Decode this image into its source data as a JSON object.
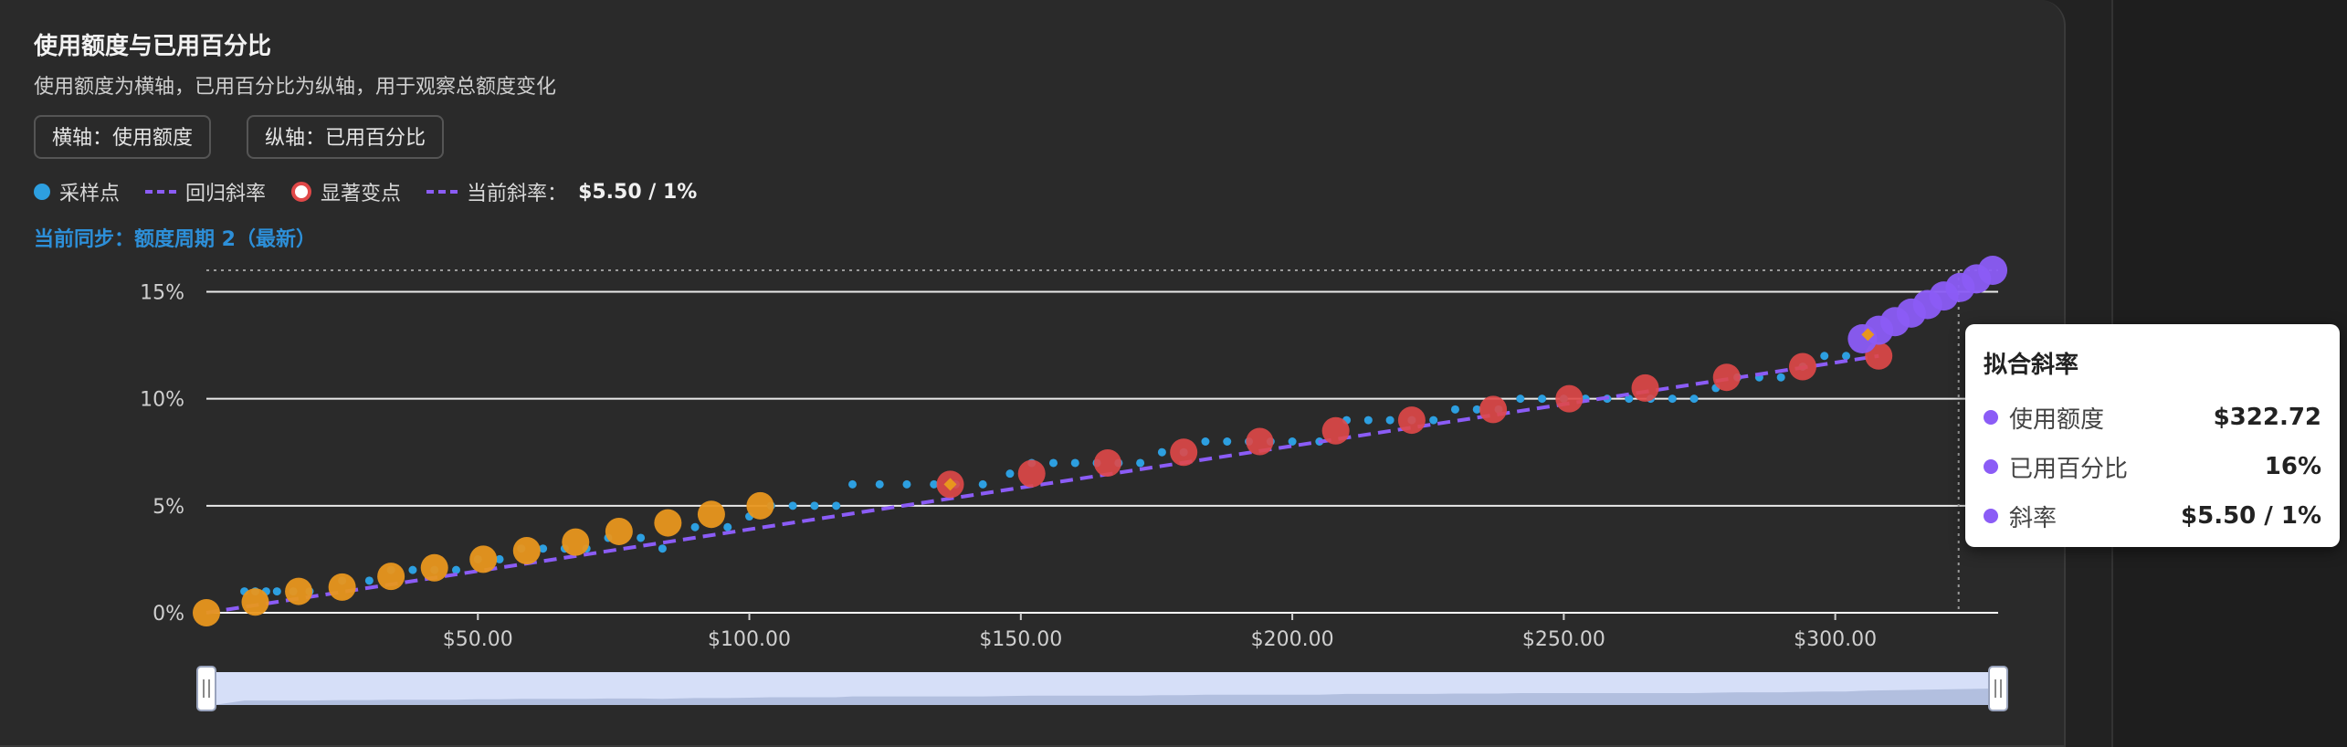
{
  "header": {
    "title": "使用额度与已用百分比",
    "subtitle": "使用额度为横轴，已用百分比为纵轴，用于观察总额度变化",
    "x_axis_button": "横轴：使用额度",
    "y_axis_button": "纵轴：已用百分比"
  },
  "legend": {
    "samples": "采样点",
    "regression": "回归斜率",
    "changepoints": "显著变点",
    "current_slope_label": "当前斜率：",
    "current_slope_value": "$5.50 / 1%"
  },
  "sync_status": "当前同步：额度周期 2（最新）",
  "colors": {
    "sample": "#2d9fe0",
    "regression": "#8b5cf6",
    "changepoint": "#e04848",
    "cycle1": "#e8961e",
    "current": "#8b5cf6",
    "grid": "#ffffff",
    "zoom_fill": "#d6dff8"
  },
  "chart_data": {
    "type": "scatter",
    "xlim": [
      0,
      330
    ],
    "ylim": [
      0,
      16
    ],
    "x_ticks": [
      "$50.00",
      "$100.00",
      "$150.00",
      "$200.00",
      "$250.00",
      "$300.00"
    ],
    "x_tick_values": [
      50,
      100,
      150,
      200,
      250,
      300
    ],
    "y_ticks": [
      "0%",
      "5%",
      "10%",
      "15%"
    ],
    "y_tick_values": [
      0,
      5,
      10,
      15
    ],
    "grid": true,
    "reference_line_y": 16,
    "crosshair_x": 322.72,
    "samples": [
      [
        7,
        1
      ],
      [
        9,
        1
      ],
      [
        11,
        1
      ],
      [
        13,
        1
      ],
      [
        16,
        1
      ],
      [
        19,
        1
      ],
      [
        25,
        1.5
      ],
      [
        30,
        1.5
      ],
      [
        34,
        2
      ],
      [
        38,
        2
      ],
      [
        42,
        2
      ],
      [
        46,
        2
      ],
      [
        50,
        2.5
      ],
      [
        54,
        2.5
      ],
      [
        58,
        3
      ],
      [
        62,
        3
      ],
      [
        66,
        3
      ],
      [
        70,
        3
      ],
      [
        74,
        3.5
      ],
      [
        80,
        3.5
      ],
      [
        84,
        3
      ],
      [
        90,
        4
      ],
      [
        96,
        4
      ],
      [
        100,
        4.5
      ],
      [
        104,
        5
      ],
      [
        108,
        5
      ],
      [
        112,
        5
      ],
      [
        116,
        5
      ],
      [
        119,
        6
      ],
      [
        124,
        6
      ],
      [
        129,
        6
      ],
      [
        134,
        6
      ],
      [
        138,
        6
      ],
      [
        143,
        6
      ],
      [
        148,
        6.5
      ],
      [
        152,
        7
      ],
      [
        156,
        7
      ],
      [
        160,
        7
      ],
      [
        164,
        7
      ],
      [
        168,
        7
      ],
      [
        172,
        7
      ],
      [
        176,
        7.5
      ],
      [
        180,
        7.5
      ],
      [
        184,
        8
      ],
      [
        188,
        8
      ],
      [
        192,
        8
      ],
      [
        196,
        8
      ],
      [
        200,
        8
      ],
      [
        205,
        8
      ],
      [
        210,
        9
      ],
      [
        214,
        9
      ],
      [
        218,
        9
      ],
      [
        222,
        9
      ],
      [
        226,
        9
      ],
      [
        230,
        9.5
      ],
      [
        234,
        9.5
      ],
      [
        238,
        9.5
      ],
      [
        242,
        10
      ],
      [
        246,
        10
      ],
      [
        250,
        10
      ],
      [
        254,
        10
      ],
      [
        258,
        10
      ],
      [
        262,
        10
      ],
      [
        266,
        10
      ],
      [
        270,
        10
      ],
      [
        274,
        10
      ],
      [
        278,
        10.5
      ],
      [
        282,
        11
      ],
      [
        286,
        11
      ],
      [
        290,
        11
      ],
      [
        294,
        11.5
      ],
      [
        298,
        12
      ],
      [
        302,
        12
      ],
      [
        306,
        13
      ]
    ],
    "regression": {
      "x": [
        0,
        308
      ],
      "y": [
        0,
        12
      ]
    },
    "changepoints": [
      [
        137,
        6
      ],
      [
        152,
        6.5
      ],
      [
        166,
        7
      ],
      [
        180,
        7.5
      ],
      [
        194,
        8
      ],
      [
        208,
        8.5
      ],
      [
        222,
        9
      ],
      [
        237,
        9.5
      ],
      [
        251,
        10
      ],
      [
        265,
        10.5
      ],
      [
        280,
        11
      ],
      [
        294,
        11.5
      ],
      [
        308,
        12
      ]
    ],
    "cycle1_points": [
      [
        0,
        0
      ],
      [
        9,
        0.5
      ],
      [
        17,
        1
      ],
      [
        25,
        1.2
      ],
      [
        34,
        1.7
      ],
      [
        42,
        2.1
      ],
      [
        51,
        2.5
      ],
      [
        59,
        2.9
      ],
      [
        68,
        3.3
      ],
      [
        76,
        3.8
      ],
      [
        85,
        4.2
      ],
      [
        93,
        4.6
      ],
      [
        102,
        5
      ]
    ],
    "current_points": [
      [
        305,
        12.8
      ],
      [
        308,
        13.2
      ],
      [
        311,
        13.6
      ],
      [
        314,
        14
      ],
      [
        317,
        14.4
      ],
      [
        320,
        14.8
      ],
      [
        323,
        15.2
      ],
      [
        326,
        15.6
      ],
      [
        329,
        16
      ]
    ],
    "cycle_markers": [
      [
        137,
        6
      ],
      [
        306,
        13
      ]
    ],
    "zoom_range": [
      0,
      100
    ]
  },
  "tooltip": {
    "title": "拟合斜率",
    "rows": [
      {
        "label": "使用额度",
        "value": "$322.72"
      },
      {
        "label": "已用百分比",
        "value": "16%"
      },
      {
        "label": "斜率",
        "value": "$5.50 / 1%"
      }
    ]
  }
}
